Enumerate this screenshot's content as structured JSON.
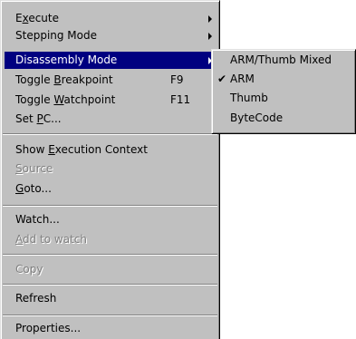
{
  "main_menu": {
    "execute": {
      "label": "Execute",
      "underline": "x"
    },
    "stepping_mode": {
      "label": "Stepping Mode"
    },
    "disassembly_mode": {
      "label": "Disassembly Mode"
    },
    "toggle_breakpoint": {
      "label": "Toggle Breakpoint",
      "underline": "B",
      "shortcut": "F9"
    },
    "toggle_watchpoint": {
      "label": "Toggle Watchpoint",
      "underline": "W",
      "shortcut": "F11"
    },
    "set_pc": {
      "label": "Set PC...",
      "underline": "P"
    },
    "show_execution_context": {
      "label": "Show Execution Context",
      "underline": "E"
    },
    "source": {
      "label": "Source",
      "underline": "S"
    },
    "goto": {
      "label": "Goto...",
      "underline": "G"
    },
    "watch": {
      "label": "Watch..."
    },
    "add_to_watch": {
      "label": "Add to watch",
      "underline": "A"
    },
    "copy": {
      "label": "Copy"
    },
    "refresh": {
      "label": "Refresh"
    },
    "properties": {
      "label": "Properties..."
    }
  },
  "disassembly_submenu": {
    "items": [
      {
        "label": "ARM/Thumb Mixed",
        "checked": false
      },
      {
        "label": "ARM",
        "checked": true
      },
      {
        "label": "Thumb",
        "checked": false
      },
      {
        "label": "ByteCode",
        "checked": false
      }
    ],
    "check_icon": "checkmark-icon"
  },
  "colors": {
    "menu_background": "#c0c0c0",
    "highlight": "#000080",
    "disabled_text": "#808080"
  }
}
